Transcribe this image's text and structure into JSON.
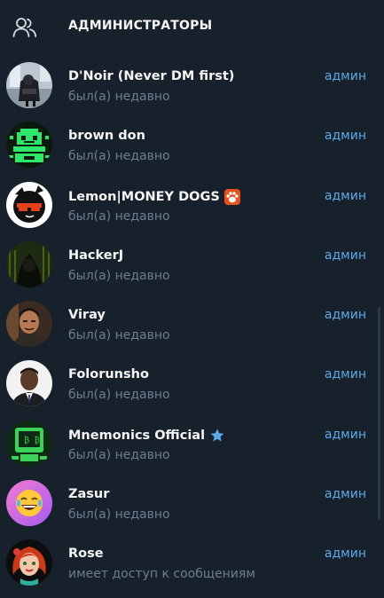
{
  "header": {
    "title": "АДМИНИСТРАТОРЫ",
    "icon": "people-icon"
  },
  "admins": [
    {
      "name": "D'Noir (Never DM first)",
      "status": "был(а) недавно",
      "role": "админ",
      "avatar": "avatar-chair-figure"
    },
    {
      "name": "brown don",
      "status": "был(а) недавно",
      "role": "админ",
      "avatar": "avatar-green-pixel-robot"
    },
    {
      "name": "Lemon|MONEY DOGS",
      "status": "был(а) недавно",
      "role": "админ",
      "avatar": "avatar-dog-sunglasses",
      "badge": "paw-icon"
    },
    {
      "name": "HackerJ",
      "status": "был(а) недавно",
      "role": "админ",
      "avatar": "avatar-hooded-hacker"
    },
    {
      "name": "Viray",
      "status": "был(а) недавно",
      "role": "админ",
      "avatar": "avatar-man-portrait"
    },
    {
      "name": "Folorunsho",
      "status": "был(а) недавно",
      "role": "админ",
      "avatar": "avatar-man-suit"
    },
    {
      "name": "Mnemonics Official",
      "status": "был(а) недавно",
      "role": "админ",
      "avatar": "avatar-bitcoin-robot",
      "badge": "star-icon"
    },
    {
      "name": "Zasur",
      "status": "был(а) недавно",
      "role": "админ",
      "avatar": "avatar-laughing-emoji"
    },
    {
      "name": "Rose",
      "status": "имеет доступ к сообщениям",
      "role": "админ",
      "avatar": "avatar-redhead-girl"
    }
  ],
  "colors": {
    "background": "#17212b",
    "name_text": "#f5f5f5",
    "status_text": "#6d7f8f",
    "role_text": "#5ea9e8",
    "paw_badge": "#e8501e",
    "star_badge": "#5ea9e8"
  }
}
